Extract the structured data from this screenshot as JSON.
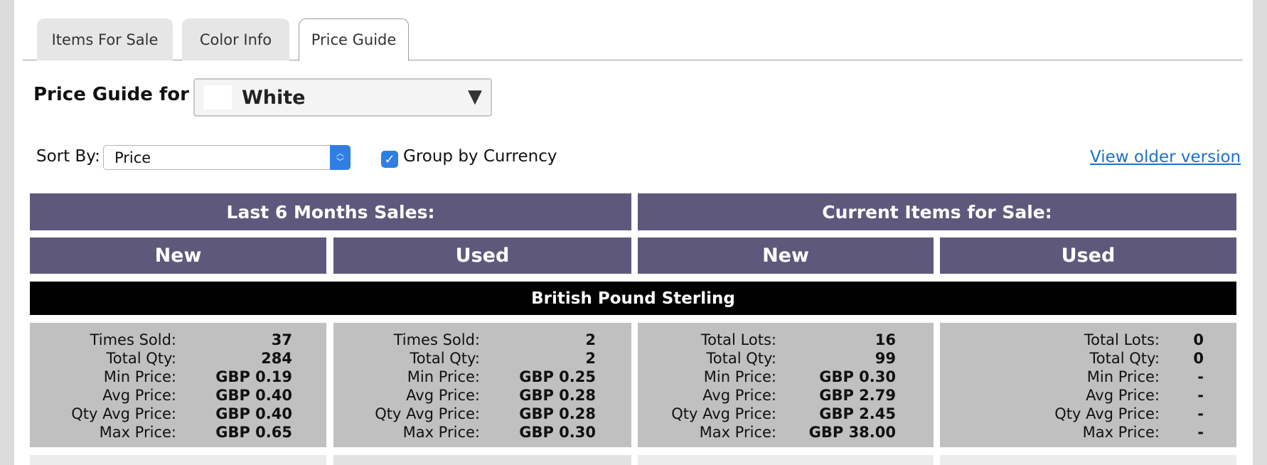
{
  "tabs": [
    {
      "label": "Items For Sale"
    },
    {
      "label": "Color Info"
    },
    {
      "label": "Price Guide"
    }
  ],
  "price_guide": {
    "label": "Price Guide for",
    "selected_color": "White",
    "swatch_color": "#ffffff"
  },
  "sort": {
    "label": "Sort By:",
    "value": "Price"
  },
  "group_by_currency": {
    "label": "Group by Currency",
    "checked": true
  },
  "older_version_link": "View older version",
  "table": {
    "sections": [
      {
        "title": "Last 6 Months Sales:"
      },
      {
        "title": "Current Items for Sale:"
      }
    ],
    "conditions": [
      "New",
      "Used",
      "New",
      "Used"
    ],
    "currency": "British Pound Sterling",
    "cells": [
      {
        "rows": [
          {
            "k": "Times Sold:",
            "v": "37"
          },
          {
            "k": "Total Qty:",
            "v": "284"
          },
          {
            "k": "Min Price:",
            "v": "GBP 0.19"
          },
          {
            "k": "Avg Price:",
            "v": "GBP 0.40"
          },
          {
            "k": "Qty Avg Price:",
            "v": "GBP 0.40"
          },
          {
            "k": "Max Price:",
            "v": "GBP 0.65"
          }
        ]
      },
      {
        "rows": [
          {
            "k": "Times Sold:",
            "v": "2"
          },
          {
            "k": "Total Qty:",
            "v": "2"
          },
          {
            "k": "Min Price:",
            "v": "GBP 0.25"
          },
          {
            "k": "Avg Price:",
            "v": "GBP 0.28"
          },
          {
            "k": "Qty Avg Price:",
            "v": "GBP 0.28"
          },
          {
            "k": "Max Price:",
            "v": "GBP 0.30"
          }
        ]
      },
      {
        "rows": [
          {
            "k": "Total Lots:",
            "v": "16"
          },
          {
            "k": "Total Qty:",
            "v": "99"
          },
          {
            "k": "Min Price:",
            "v": "GBP 0.30"
          },
          {
            "k": "Avg Price:",
            "v": "GBP 2.79"
          },
          {
            "k": "Qty Avg Price:",
            "v": "GBP 2.45"
          },
          {
            "k": "Max Price:",
            "v": "GBP 38.00"
          }
        ]
      },
      {
        "rows": [
          {
            "k": "Total Lots:",
            "v": "0"
          },
          {
            "k": "Total Qty:",
            "v": "0"
          },
          {
            "k": "Min Price:",
            "v": "-"
          },
          {
            "k": "Avg Price:",
            "v": "-"
          },
          {
            "k": "Qty Avg Price:",
            "v": "-"
          },
          {
            "k": "Max Price:",
            "v": "-"
          }
        ]
      }
    ]
  },
  "colors": {
    "header_bg": "#5e597c",
    "currency_bg": "#000000",
    "cell_bg": "#c0c0c0",
    "link": "#1a73c9",
    "checkbox": "#2f7fe3"
  }
}
